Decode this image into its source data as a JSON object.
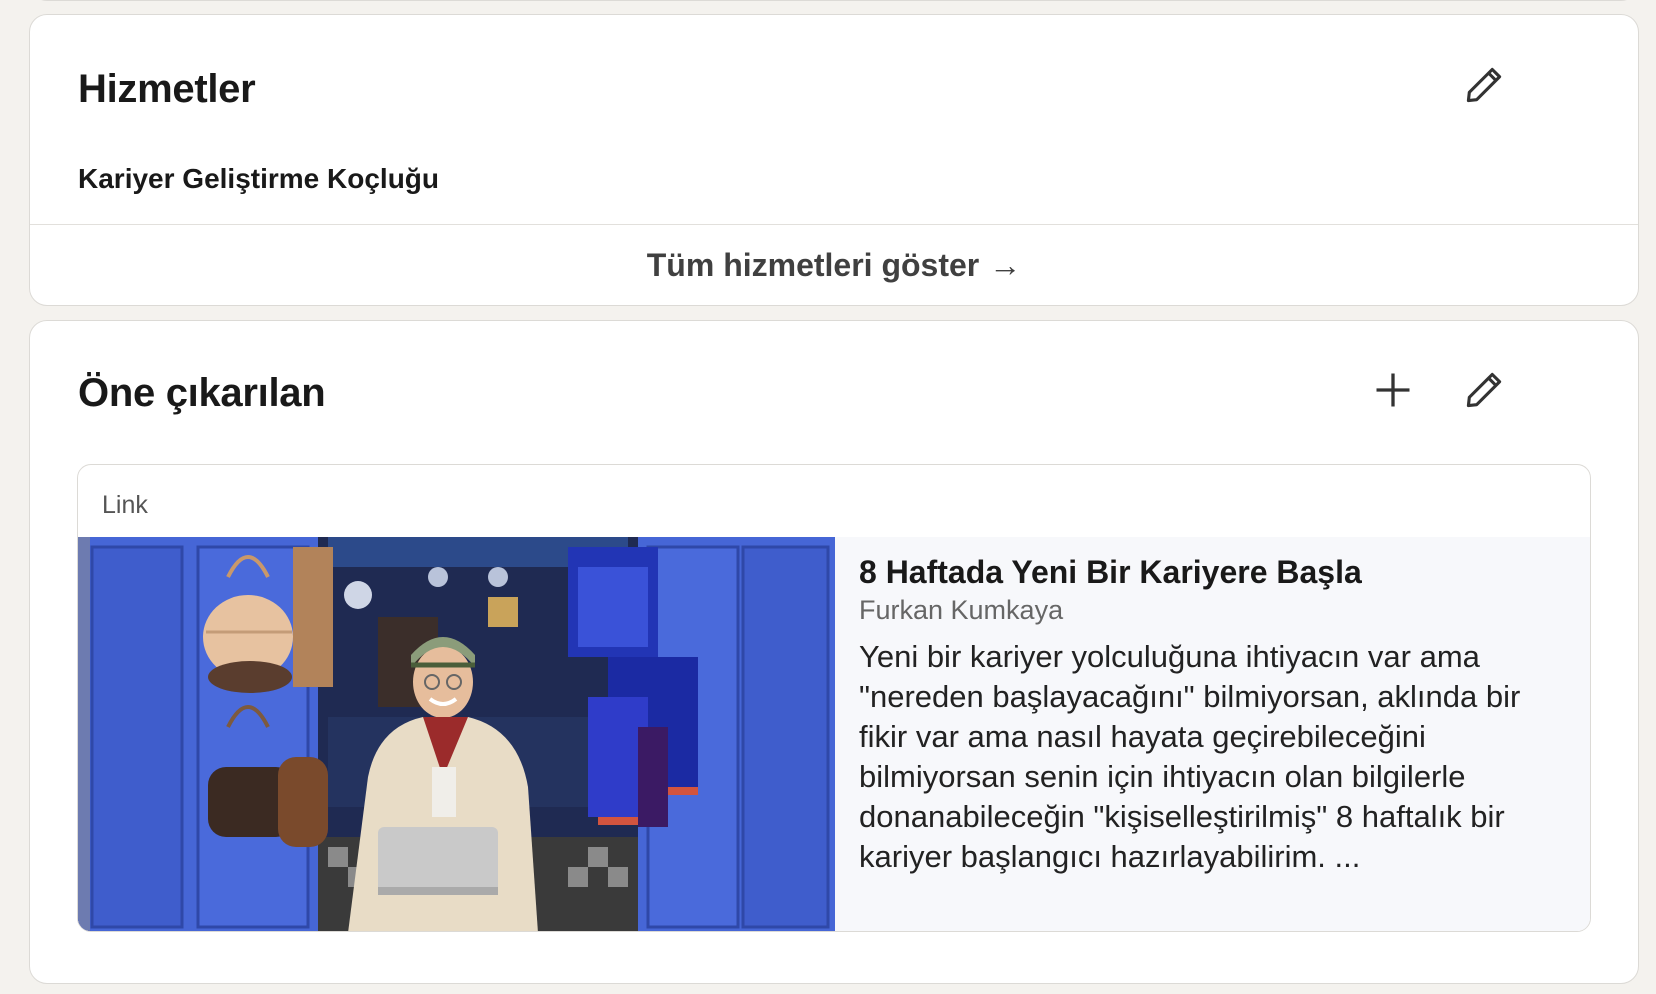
{
  "services": {
    "title": "Hizmetler",
    "items": [
      "Kariyer Geliştirme Koçluğu"
    ],
    "show_all_label": "Tüm hizmetleri göster",
    "show_all_arrow": "→"
  },
  "featured": {
    "title": "Öne çıkarılan",
    "item": {
      "type": "Link",
      "title": "8 Haftada Yeni Bir Kariyere Başla",
      "author": "Furkan Kumkaya",
      "description": "Yeni bir kariyer yolculuğuna ihtiyacın var ama \"nereden başlayacağını\" bilmiyorsan, aklında bir fikir var ama nasıl hayata geçirebileceğini bilmiyorsan senin için ihtiyacın olan bilgilerle donanabileceğin \"kişiselleştirilmiş\" 8 haftalık bir kariyer başlangıcı hazırlayabilirim. ..."
    }
  },
  "icons": {
    "edit": "pencil-icon",
    "add": "plus-icon"
  },
  "colors": {
    "background": "#f4f2ee",
    "card": "#ffffff",
    "text": "#191919",
    "door_blue": "#3e5cc9"
  }
}
